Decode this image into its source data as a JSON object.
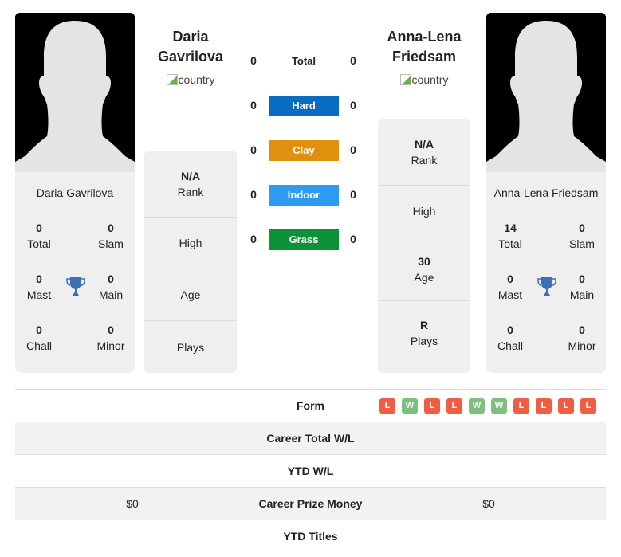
{
  "players": {
    "left": {
      "name_line1": "Daria",
      "name_line2": "Gavrilova",
      "full_name": "Daria Gavrilova",
      "country_alt": "country",
      "titles": {
        "total": "0",
        "slam": "0",
        "mast": "0",
        "main": "0",
        "chall": "0",
        "minor": "0"
      },
      "info": {
        "rank_value": "N/A",
        "rank_label": "Rank",
        "high_value": "",
        "high_label": "High",
        "age_value": "",
        "age_label": "Age",
        "plays_value": "",
        "plays_label": "Plays"
      }
    },
    "right": {
      "name_line1": "Anna-Lena",
      "name_line2": "Friedsam",
      "full_name": "Anna-Lena Friedsam",
      "country_alt": "country",
      "titles": {
        "total": "14",
        "slam": "0",
        "mast": "0",
        "main": "0",
        "chall": "0",
        "minor": "0"
      },
      "info": {
        "rank_value": "N/A",
        "rank_label": "Rank",
        "high_value": "",
        "high_label": "High",
        "age_value": "30",
        "age_label": "Age",
        "plays_value": "R",
        "plays_label": "Plays"
      }
    }
  },
  "title_labels": {
    "total": "Total",
    "slam": "Slam",
    "mast": "Mast",
    "main": "Main",
    "chall": "Chall",
    "minor": "Minor"
  },
  "surfaces": [
    {
      "label": "Total",
      "left": "0",
      "right": "0",
      "color": ""
    },
    {
      "label": "Hard",
      "left": "0",
      "right": "0",
      "color": "#0a6bc2"
    },
    {
      "label": "Clay",
      "left": "0",
      "right": "0",
      "color": "#e0900c"
    },
    {
      "label": "Indoor",
      "left": "0",
      "right": "0",
      "color": "#2c9cf2"
    },
    {
      "label": "Grass",
      "left": "0",
      "right": "0",
      "color": "#0c9238"
    }
  ],
  "comparison": {
    "form_label": "Form",
    "form": [
      "L",
      "W",
      "L",
      "L",
      "W",
      "W",
      "L",
      "L",
      "L",
      "L"
    ],
    "form_colors": {
      "W": "#7dbf7d",
      "L": "#ef5d43"
    },
    "rows": [
      {
        "label": "Career Total W/L",
        "left": "",
        "right": ""
      },
      {
        "label": "YTD W/L",
        "left": "",
        "right": ""
      },
      {
        "label": "Career Prize Money",
        "left": "$0",
        "right": "$0"
      },
      {
        "label": "YTD Titles",
        "left": "",
        "right": ""
      }
    ]
  },
  "colors": {
    "trophy": "#3b6fb6",
    "card_bg": "#efefef"
  }
}
